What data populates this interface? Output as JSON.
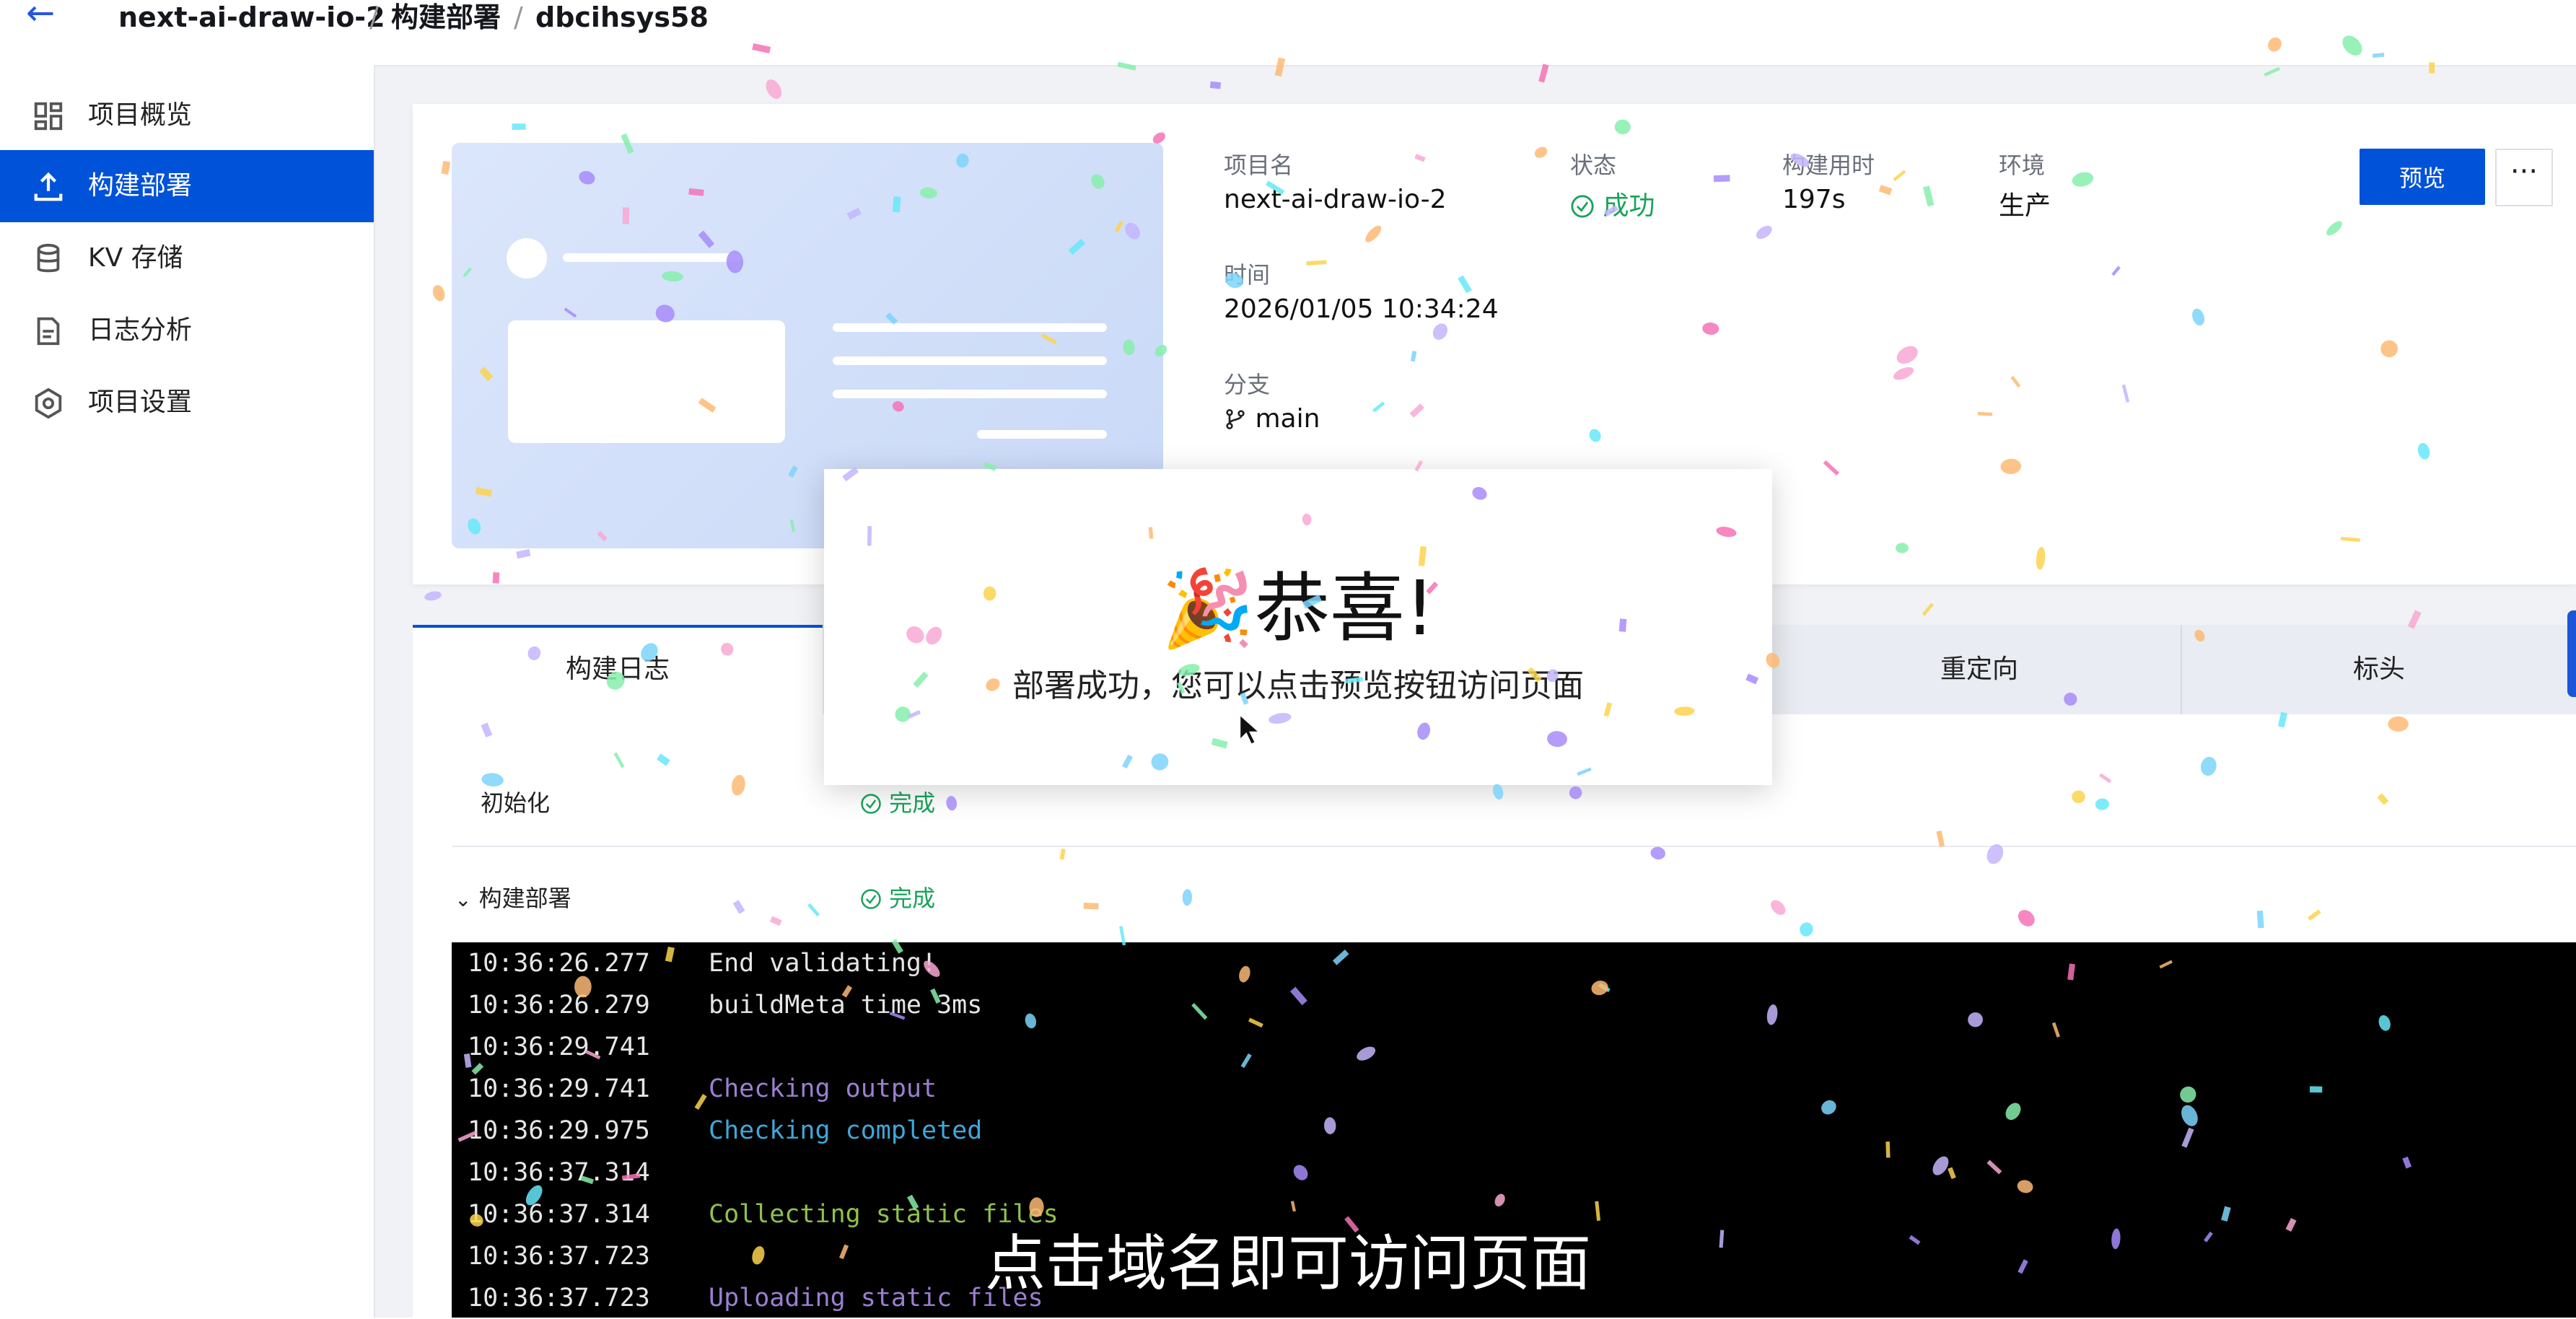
{
  "breadcrumb": {
    "project": "next-ai-draw-io-2",
    "section": "构建部署",
    "deployment": "dbcihsys58",
    "separator": "/"
  },
  "sidebar": {
    "items": [
      {
        "label": "项目概览",
        "icon": "dashboard-icon",
        "active": false
      },
      {
        "label": "构建部署",
        "icon": "upload-icon",
        "active": true
      },
      {
        "label": "KV 存储",
        "icon": "database-icon",
        "active": false
      },
      {
        "label": "日志分析",
        "icon": "document-icon",
        "active": false
      },
      {
        "label": "项目设置",
        "icon": "settings-icon",
        "active": false
      }
    ]
  },
  "overview": {
    "project_label": "项目名",
    "project_value": "next-ai-draw-io-2",
    "status_label": "状态",
    "status_value": "成功",
    "duration_label": "构建用时",
    "duration_value": "197s",
    "env_label": "环境",
    "env_value": "生产",
    "time_label": "时间",
    "time_value": "2026/01/05 10:34:24",
    "branch_label": "分支",
    "branch_value": "main",
    "preview_button": "预览",
    "more_button": "···"
  },
  "tabs": [
    {
      "label": "构建日志"
    },
    {
      "label": "重定向"
    },
    {
      "label": "标头"
    }
  ],
  "steps": [
    {
      "name": "初始化",
      "status": "完成"
    },
    {
      "name": "构建部署",
      "status": "完成"
    }
  ],
  "log": [
    {
      "ts": "10:36:26.277",
      "msg": "End validating!",
      "color": "#e6e6e6"
    },
    {
      "ts": "10:36:26.279",
      "msg": "buildMeta time 3ms",
      "color": "#e6e6e6"
    },
    {
      "ts": "10:36:29.741",
      "msg": "",
      "color": "#e6e6e6"
    },
    {
      "ts": "10:36:29.741",
      "msg": "Checking output",
      "color": "#9b7fd1"
    },
    {
      "ts": "10:36:29.975",
      "msg": "Checking completed",
      "color": "#3fa7d8"
    },
    {
      "ts": "10:36:37.314",
      "msg": "",
      "color": "#e6e6e6"
    },
    {
      "ts": "10:36:37.314",
      "msg": "Collecting static files",
      "color": "#8fc24a"
    },
    {
      "ts": "10:36:37.723",
      "msg": "",
      "color": "#e6e6e6"
    },
    {
      "ts": "10:36:37.723",
      "msg": "Uploading static files",
      "color": "#9b7fd1"
    }
  ],
  "modal": {
    "title": "🎉恭喜!",
    "message": "部署成功，您可以点击预览按钮访问页面"
  },
  "subtitle": "点击域名即可访问页面",
  "colors": {
    "primary": "#0052d9",
    "success": "#1aa35a",
    "terminal_bg": "#000000"
  }
}
